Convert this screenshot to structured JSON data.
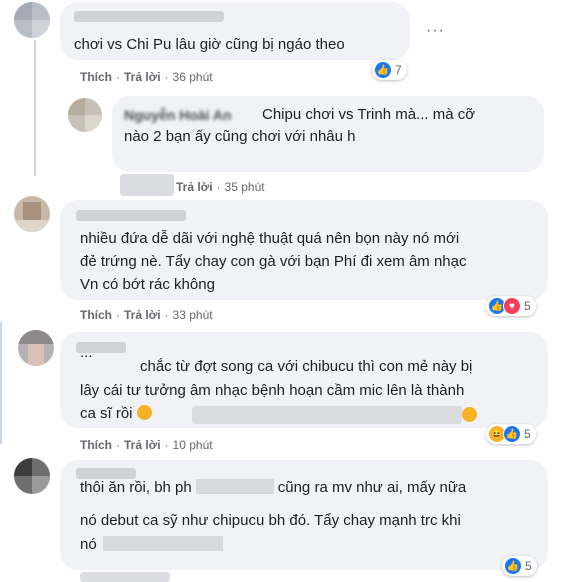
{
  "comments": [
    {
      "name": "",
      "lines": [
        "chơi vs Chi Pu lâu giờ cũng bị ngáo theo"
      ],
      "actions": {
        "like": "Thích",
        "reply": "Trả lời",
        "time": "36 phút"
      },
      "reactions": {
        "icons": [
          "like"
        ],
        "count": "7"
      },
      "more_icon": "more-dots-icon"
    },
    {
      "name": "Nguyễn Hoài An",
      "lines": [
        "Chipu chơi vs Trinh mà... mà cỡ",
        "nào 2 bạn ấy cũng chơi với nhâu h"
      ],
      "actions": {
        "like": "",
        "reply": "Trả lời",
        "time": "35 phút"
      }
    },
    {
      "name": "",
      "lines": [
        "nhiều đứa dễ dãi với nghệ thuật quá nên bọn này nó mới",
        "đẻ trứng nè. Tẩy chay con gà với bạn Phí đi xem âm nhạc",
        "Vn có bớt rác không"
      ],
      "actions": {
        "like": "Thích",
        "reply": "Trả lời",
        "time": "33 phút"
      },
      "reactions": {
        "icons": [
          "like",
          "love"
        ],
        "count": "5"
      }
    },
    {
      "name": "",
      "lines": [
        "chắc từ đợt song ca với chibucu thì con mẻ này bị",
        "lây cái tư tưởng âm nhạc bệnh hoạn cầm mic lên là thành",
        "ca sĩ rồi"
      ],
      "line_prefix": "...",
      "actions": {
        "like": "Thích",
        "reply": "Trả lời",
        "time": "10 phút"
      },
      "reactions": {
        "icons": [
          "haha",
          "like"
        ],
        "count": "5"
      }
    },
    {
      "name": "",
      "lines": [
        "thôi ăn rồi, bh ph",
        "cũng ra mv như ai, mấy nữa",
        "nó debut ca sỹ như chipucu bh đó. Tẩy chay mạnh trc khi",
        "nó"
      ],
      "reactions": {
        "icons": [
          "like"
        ],
        "count": "5"
      }
    }
  ]
}
